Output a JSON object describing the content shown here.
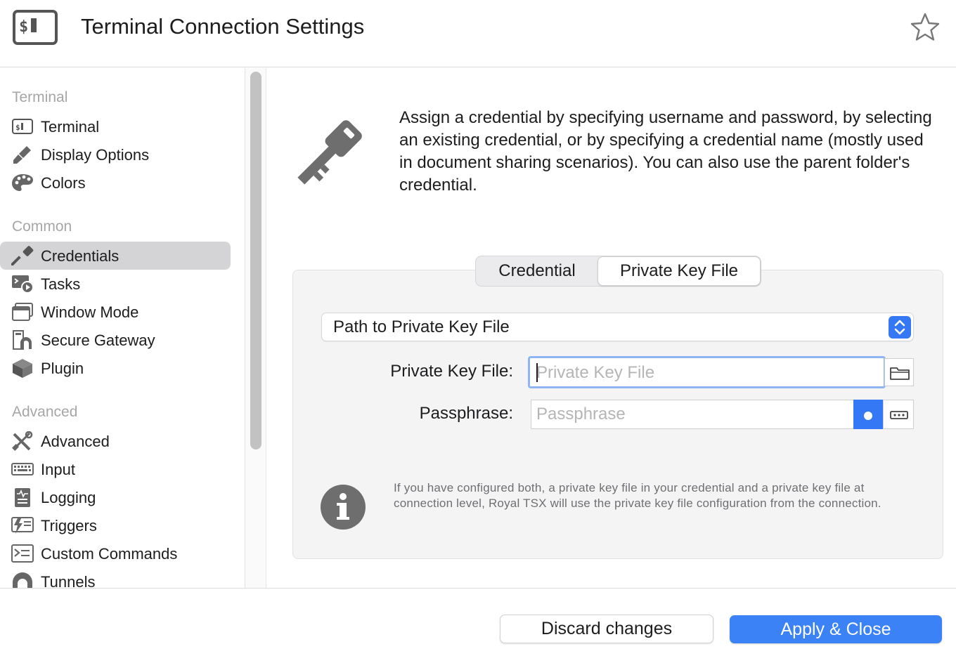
{
  "window": {
    "title": "Terminal Connection Settings",
    "app_icon": "terminal-icon",
    "favorite_icon": "star-icon"
  },
  "sidebar": {
    "sections": [
      {
        "heading": "Terminal",
        "items": [
          {
            "label": "Terminal",
            "icon": "terminal-icon"
          },
          {
            "label": "Display Options",
            "icon": "brush-icon"
          },
          {
            "label": "Colors",
            "icon": "palette-icon"
          }
        ]
      },
      {
        "heading": "Common",
        "items": [
          {
            "label": "Credentials",
            "icon": "key-icon",
            "selected": true
          },
          {
            "label": "Tasks",
            "icon": "tasks-icon"
          },
          {
            "label": "Window Mode",
            "icon": "window-icon"
          },
          {
            "label": "Secure Gateway",
            "icon": "gateway-icon"
          },
          {
            "label": "Plugin",
            "icon": "plugin-icon"
          }
        ]
      },
      {
        "heading": "Advanced",
        "items": [
          {
            "label": "Advanced",
            "icon": "tools-icon"
          },
          {
            "label": "Input",
            "icon": "keyboard-icon"
          },
          {
            "label": "Logging",
            "icon": "log-icon"
          },
          {
            "label": "Triggers",
            "icon": "trigger-icon"
          },
          {
            "label": "Custom Commands",
            "icon": "command-icon"
          },
          {
            "label": "Tunnels",
            "icon": "tunnel-icon"
          }
        ]
      }
    ]
  },
  "main": {
    "description": "Assign a credential by specifying username and password, by selecting an existing credential, or by specifying a credential name (mostly used in document sharing scenarios). You can also use the parent folder's credential.",
    "tabs": [
      {
        "label": "Credential",
        "selected": false
      },
      {
        "label": "Private Key File",
        "selected": true
      }
    ],
    "mode_select": {
      "value": "Path to Private Key File"
    },
    "private_key_field": {
      "label": "Private Key File:",
      "value": "",
      "placeholder": "Private Key File"
    },
    "passphrase_field": {
      "label": "Passphrase:",
      "value": "",
      "placeholder": "Passphrase"
    },
    "info_text": "If you have configured both, a private key file in your credential and a private key file at connection level, Royal TSX will use the private key file configuration from the connection."
  },
  "footer": {
    "discard_label": "Discard changes",
    "apply_label": "Apply & Close"
  },
  "colors": {
    "accent": "#3478f6",
    "selection": "#d4d4d6",
    "section_heading": "#a6a6a6"
  }
}
